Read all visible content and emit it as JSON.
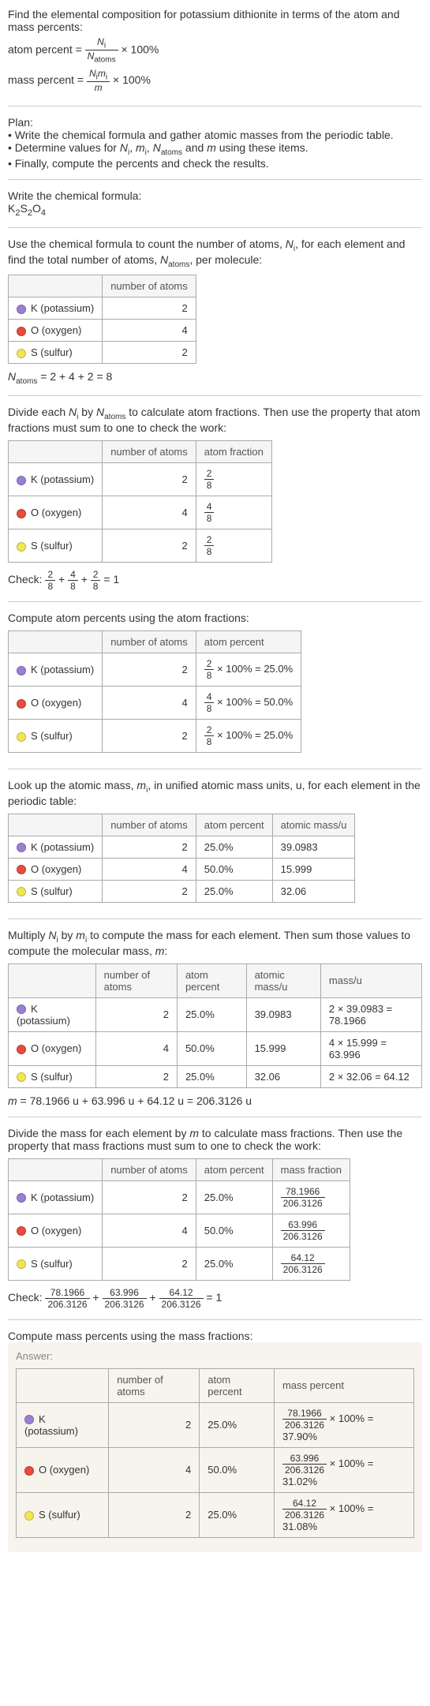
{
  "intro": {
    "prompt": "Find the elemental composition for potassium dithionite in terms of the atom and mass percents:",
    "atom_percent_label": "atom percent = ",
    "atom_percent_num": "N",
    "atom_percent_num_sub": "i",
    "atom_percent_den": "N",
    "atom_percent_den_sub": "atoms",
    "times100": " × 100%",
    "mass_percent_label": "mass percent = ",
    "mass_percent_num": "N",
    "mass_percent_num_sub": "i",
    "mass_percent_num2": "m",
    "mass_percent_num2_sub": "i",
    "mass_percent_den": "m"
  },
  "plan": {
    "heading": "Plan:",
    "b1": "• Write the chemical formula and gather atomic masses from the periodic table.",
    "b2_a": "• Determine values for ",
    "b2_b": " using these items.",
    "b3": "• Finally, compute the percents and check the results."
  },
  "formula": {
    "heading": "Write the chemical formula:",
    "f": "K",
    "s1": "2",
    "f2": "S",
    "s2": "2",
    "f3": "O",
    "s3": "4"
  },
  "count": {
    "text_a": "Use the chemical formula to count the number of atoms, ",
    "text_b": ", for each element and find the total number of atoms, ",
    "text_c": ", per molecule:",
    "col2": "number of atoms",
    "k": "K (potassium)",
    "o": "O (oxygen)",
    "s": "S (sulfur)",
    "nk": "2",
    "no": "4",
    "ns": "2",
    "sum_a": "N",
    "sum_sub": "atoms",
    "sum_b": " = 2 + 4 + 2 = 8"
  },
  "atomfrac": {
    "text": "Divide each ",
    "text2": " by ",
    "text3": " to calculate atom fractions. Then use the property that atom fractions must sum to one to check the work:",
    "col2": "number of atoms",
    "col3": "atom fraction",
    "fk_n": "2",
    "fk_d": "8",
    "fo_n": "4",
    "fo_d": "8",
    "fs_n": "2",
    "fs_d": "8",
    "check": "Check: ",
    "check_eq": " = 1"
  },
  "atompct": {
    "text": "Compute atom percents using the atom fractions:",
    "col3": "atom percent",
    "pk": " × 100% = 25.0%",
    "po": " × 100% = 50.0%",
    "ps": " × 100% = 25.0%"
  },
  "atomicmass": {
    "text_a": "Look up the atomic mass, ",
    "text_b": ", in unified atomic mass units, u, for each element in the periodic table:",
    "col4": "atomic mass/u",
    "pk": "25.0%",
    "po": "50.0%",
    "ps": "25.0%",
    "mk": "39.0983",
    "mo": "15.999",
    "ms": "32.06"
  },
  "multiply": {
    "text_a": "Multiply ",
    "text_b": " by ",
    "text_c": " to compute the mass for each element. Then sum those values to compute the molecular mass, ",
    "text_d": ":",
    "col5": "mass/u",
    "ck": "2 × 39.0983 = 78.1966",
    "co": "4 × 15.999 = 63.996",
    "cs": "2 × 32.06 = 64.12",
    "sum": " = 78.1966 u + 63.996 u + 64.12 u = 206.3126 u"
  },
  "massfrac": {
    "text_a": "Divide the mass for each element by ",
    "text_b": " to calculate mass fractions. Then use the property that mass fractions must sum to one to check the work:",
    "col4": "mass fraction",
    "nk": "78.1966",
    "no": "63.996",
    "ns": "64.12",
    "den": "206.3126",
    "check": "Check: ",
    "check_eq": " = 1"
  },
  "masspct": {
    "text": "Compute mass percents using the mass fractions:",
    "answer": "Answer:",
    "col4": "mass percent",
    "pk": " × 100% = 37.90%",
    "po": " × 100% = 31.02%",
    "ps": " × 100% = 31.08%"
  },
  "chart_data": {
    "type": "table",
    "title": "Elemental composition of potassium dithionite K2S2O4",
    "elements": [
      {
        "symbol": "K",
        "name": "potassium",
        "atoms": 2,
        "atom_percent": 25.0,
        "atomic_mass_u": 39.0983,
        "mass_u": 78.1966,
        "mass_percent": 37.9
      },
      {
        "symbol": "O",
        "name": "oxygen",
        "atoms": 4,
        "atom_percent": 50.0,
        "atomic_mass_u": 15.999,
        "mass_u": 63.996,
        "mass_percent": 31.02
      },
      {
        "symbol": "S",
        "name": "sulfur",
        "atoms": 2,
        "atom_percent": 25.0,
        "atomic_mass_u": 32.06,
        "mass_u": 64.12,
        "mass_percent": 31.08
      }
    ],
    "total_atoms": 8,
    "molecular_mass_u": 206.3126
  }
}
